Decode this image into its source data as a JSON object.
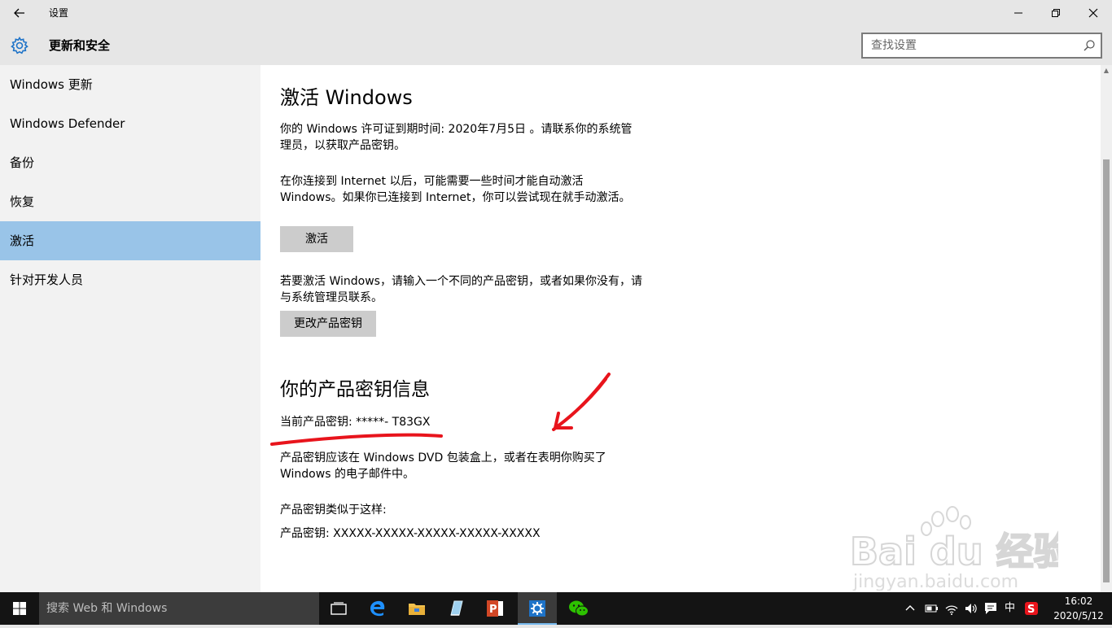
{
  "window": {
    "title": "设置",
    "back_icon": "back-arrow-icon",
    "minimize_glyph": "—",
    "maximize_glyph": "❐",
    "close_glyph": "✕"
  },
  "header": {
    "title": "更新和安全",
    "search_placeholder": "查找设置"
  },
  "sidebar": {
    "items": [
      {
        "label": "Windows 更新"
      },
      {
        "label": "Windows Defender"
      },
      {
        "label": "备份"
      },
      {
        "label": "恢复"
      },
      {
        "label": "激活",
        "selected": true
      },
      {
        "label": "针对开发人员"
      }
    ]
  },
  "main": {
    "activation_heading": "激活 Windows",
    "license_text": "你的 Windows 许可证到期时间: 2020年7月5日 。请联系你的系统管理员，以获取产品密钥。",
    "internet_text": "在你连接到 Internet 以后，可能需要一些时间才能自动激活 Windows。如果你已连接到 Internet，你可以尝试现在就手动激活。",
    "activate_button": "激活",
    "change_key_text": "若要激活 Windows，请输入一个不同的产品密钥，或者如果你没有，请与系统管理员联系。",
    "change_key_button": "更改产品密钥",
    "key_info_heading": "你的产品密钥信息",
    "current_key": "当前产品密钥: *****- T83GX",
    "key_location_text": "产品密钥应该在 Windows DVD 包装盒上，或者在表明你购买了 Windows 的电子邮件中。",
    "key_format_label": "产品密钥类似于这样:",
    "key_format_example": "产品密钥: XXXXX-XXXXX-XXXXX-XXXXX-XXXXX"
  },
  "watermark": {
    "brand": "Bai du 经验",
    "url": "jingyan.baidu.com"
  },
  "taskbar": {
    "search_text": "搜索 Web 和 Windows",
    "ime_label": "中",
    "clock_time": "16:02",
    "clock_date": "2020/5/12"
  },
  "colors": {
    "selected_nav": "#99c4e8",
    "annotation_red": "#e8141c",
    "taskbar": "#141414",
    "accent_blue": "#1e73c8"
  }
}
